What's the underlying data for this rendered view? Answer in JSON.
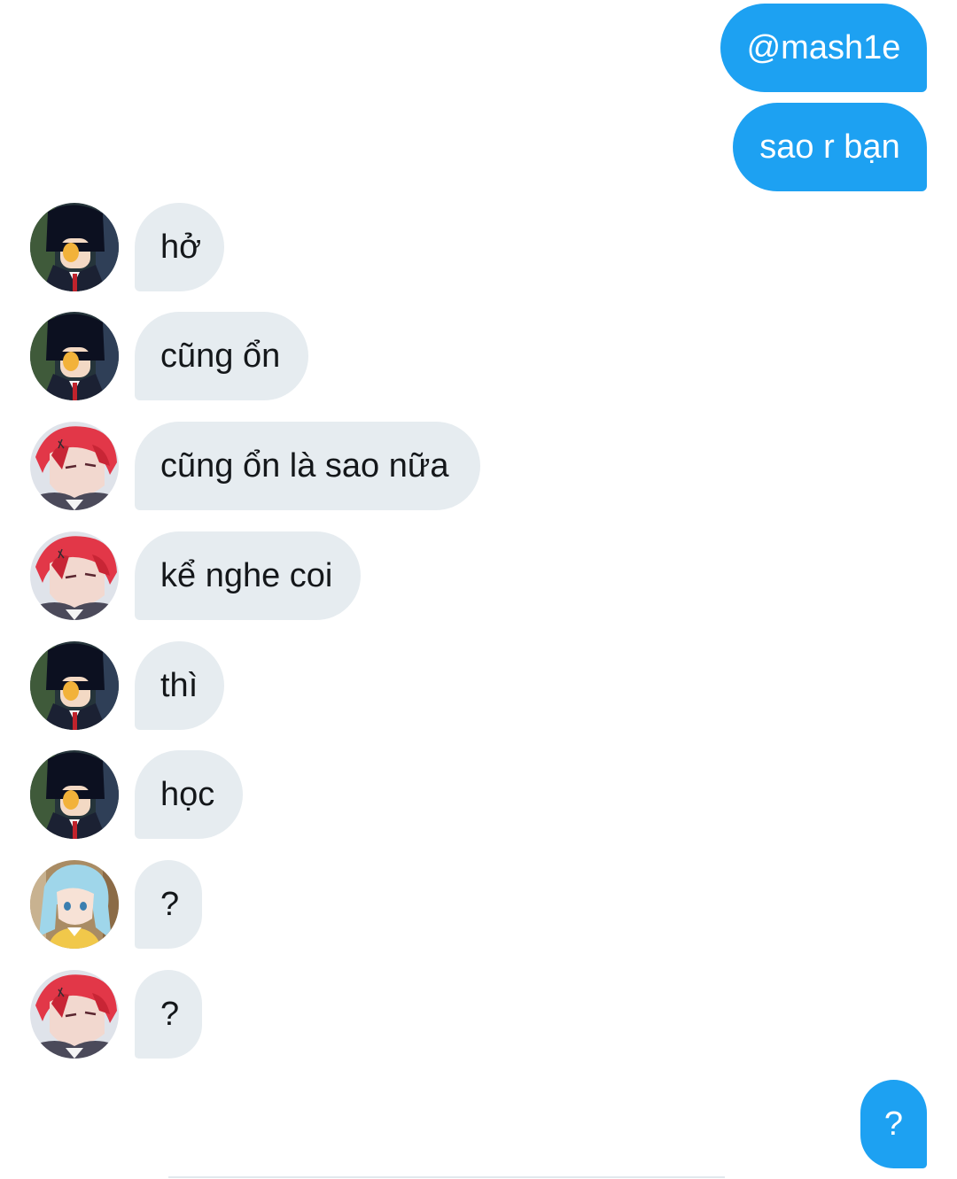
{
  "messages": [
    {
      "direction": "outgoing",
      "text": "@mash1e"
    },
    {
      "direction": "outgoing",
      "text": "sao r bạn"
    },
    {
      "direction": "incoming",
      "avatar": "dark-hair-avatar",
      "text": "hở"
    },
    {
      "direction": "incoming",
      "avatar": "dark-hair-avatar",
      "text": "cũng ổn"
    },
    {
      "direction": "incoming",
      "avatar": "red-hair-avatar",
      "text": "cũng ổn là sao nữa"
    },
    {
      "direction": "incoming",
      "avatar": "red-hair-avatar",
      "text": "kể nghe coi"
    },
    {
      "direction": "incoming",
      "avatar": "dark-hair-avatar",
      "text": "thì"
    },
    {
      "direction": "incoming",
      "avatar": "dark-hair-avatar",
      "text": "học"
    },
    {
      "direction": "incoming",
      "avatar": "light-blue-hair-avatar",
      "text": "?"
    },
    {
      "direction": "incoming",
      "avatar": "red-hair-avatar",
      "text": "?"
    },
    {
      "direction": "outgoing",
      "text": "?"
    }
  ],
  "colors": {
    "outgoing_bubble": "#1da1f2",
    "incoming_bubble": "#e6ecf0",
    "incoming_text": "#14171a",
    "outgoing_text": "#ffffff"
  }
}
